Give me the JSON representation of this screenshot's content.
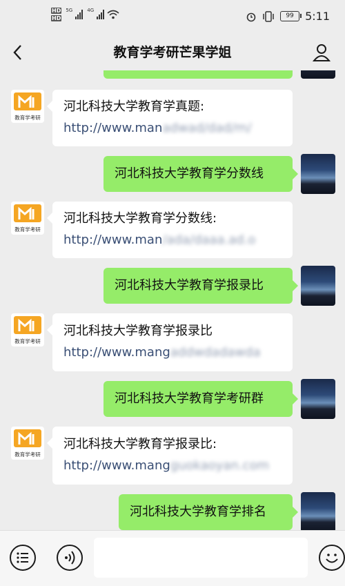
{
  "status": {
    "hd1": "HD",
    "hd2": "HD",
    "net1": "5G",
    "net2": "4G",
    "battery": "99",
    "time": "5:11"
  },
  "header": {
    "title": "教育学考研芒果学姐"
  },
  "avatar_left": {
    "caption": "教育学考研"
  },
  "messages": [
    {
      "side": "left",
      "line1": "河北科技大学教育学真题:",
      "url_clear": "http://www.man",
      "url_blur": "adwad/dad/m/"
    },
    {
      "side": "right",
      "text": "河北科技大学教育学分数线"
    },
    {
      "side": "left",
      "line1": "河北科技大学教育学分数线:",
      "url_clear": "http://www.man",
      "url_blur": "/ada/daaa.ad.o"
    },
    {
      "side": "right",
      "text": "河北科技大学教育学报录比"
    },
    {
      "side": "left",
      "line1": "河北科技大学教育学报录比",
      "url_clear": "http://www.mang",
      "url_blur": "addwdadawda"
    },
    {
      "side": "right",
      "text": "河北科技大学教育学考研群"
    },
    {
      "side": "left",
      "line1": "河北科技大学教育学报录比:",
      "url_clear": "http://www.mang",
      "url_blur": "guokaoyan.com"
    },
    {
      "side": "right",
      "text": "河北科技大学教育学排名"
    }
  ]
}
